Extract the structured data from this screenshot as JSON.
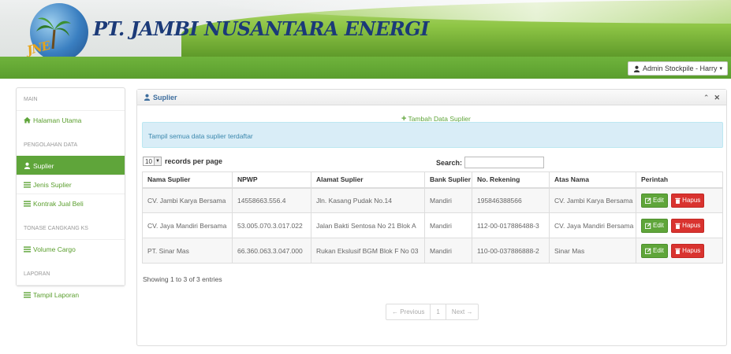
{
  "app": {
    "company_name": "PT. JAMBI NUSANTARA ENERGI",
    "logo_text": "JNE",
    "user_menu_label": "Admin Stockpile - Harry"
  },
  "sidebar": {
    "sections": [
      {
        "header": "MAIN",
        "items": [
          {
            "label": "Halaman Utama",
            "icon": "home-icon",
            "active": false
          }
        ]
      },
      {
        "header": "PENGOLAHAN DATA",
        "items": [
          {
            "label": "Suplier",
            "icon": "user-icon",
            "active": true
          },
          {
            "label": "Jenis Suplier",
            "icon": "list-icon",
            "active": false
          },
          {
            "label": "Kontrak Jual Beli",
            "icon": "list-icon",
            "active": false
          }
        ]
      },
      {
        "header": "TONASE CANGKANG KS",
        "items": [
          {
            "label": "Volume Cargo",
            "icon": "list-icon",
            "active": false
          }
        ]
      },
      {
        "header": "LAPORAN",
        "items": [
          {
            "label": "Tampil Laporan",
            "icon": "list-icon",
            "active": false
          }
        ]
      }
    ]
  },
  "panel": {
    "title": "Suplier",
    "add_label": "Tambah Data Suplier",
    "alert_text": "Tampil semua data suplier terdaftar",
    "length_value": "10",
    "length_label": "records per page",
    "search_label": "Search:",
    "search_value": ""
  },
  "table": {
    "headers": [
      "Nama Suplier",
      "NPWP",
      "Alamat Suplier",
      "Bank Suplier",
      "No. Rekening",
      "Atas Nama",
      "Perintah"
    ],
    "rows": [
      [
        "CV. Jambi Karya Bersama",
        "14558663.556.4",
        "Jln. Kasang Pudak No.14",
        "Mandiri",
        "195846388566",
        "CV. Jambi Karya Bersama"
      ],
      [
        "CV. Jaya Mandiri Bersama",
        "53.005.070.3.017.022",
        "Jalan Bakti Sentosa No 21 Blok A",
        "Mandiri",
        "112-00-017886488-3",
        "CV. Jaya Mandiri Bersama"
      ],
      [
        "PT. Sinar Mas",
        "66.360.063.3.047.000",
        "Rukan Ekslusif BGM Blok F No 03",
        "Mandiri",
        "110-00-037886888-2",
        "Sinar Mas"
      ]
    ],
    "edit_label": "Edit",
    "delete_label": "Hapus",
    "info": "Showing 1 to 3 of 3 entries"
  },
  "pagination": {
    "previous": "← Previous",
    "page": "1",
    "next": "Next →"
  },
  "colors": {
    "brand_green": "#5fa53a",
    "danger_red": "#d9332f",
    "alert_blue": "#d9edf7",
    "company_blue": "#1b3a78"
  }
}
